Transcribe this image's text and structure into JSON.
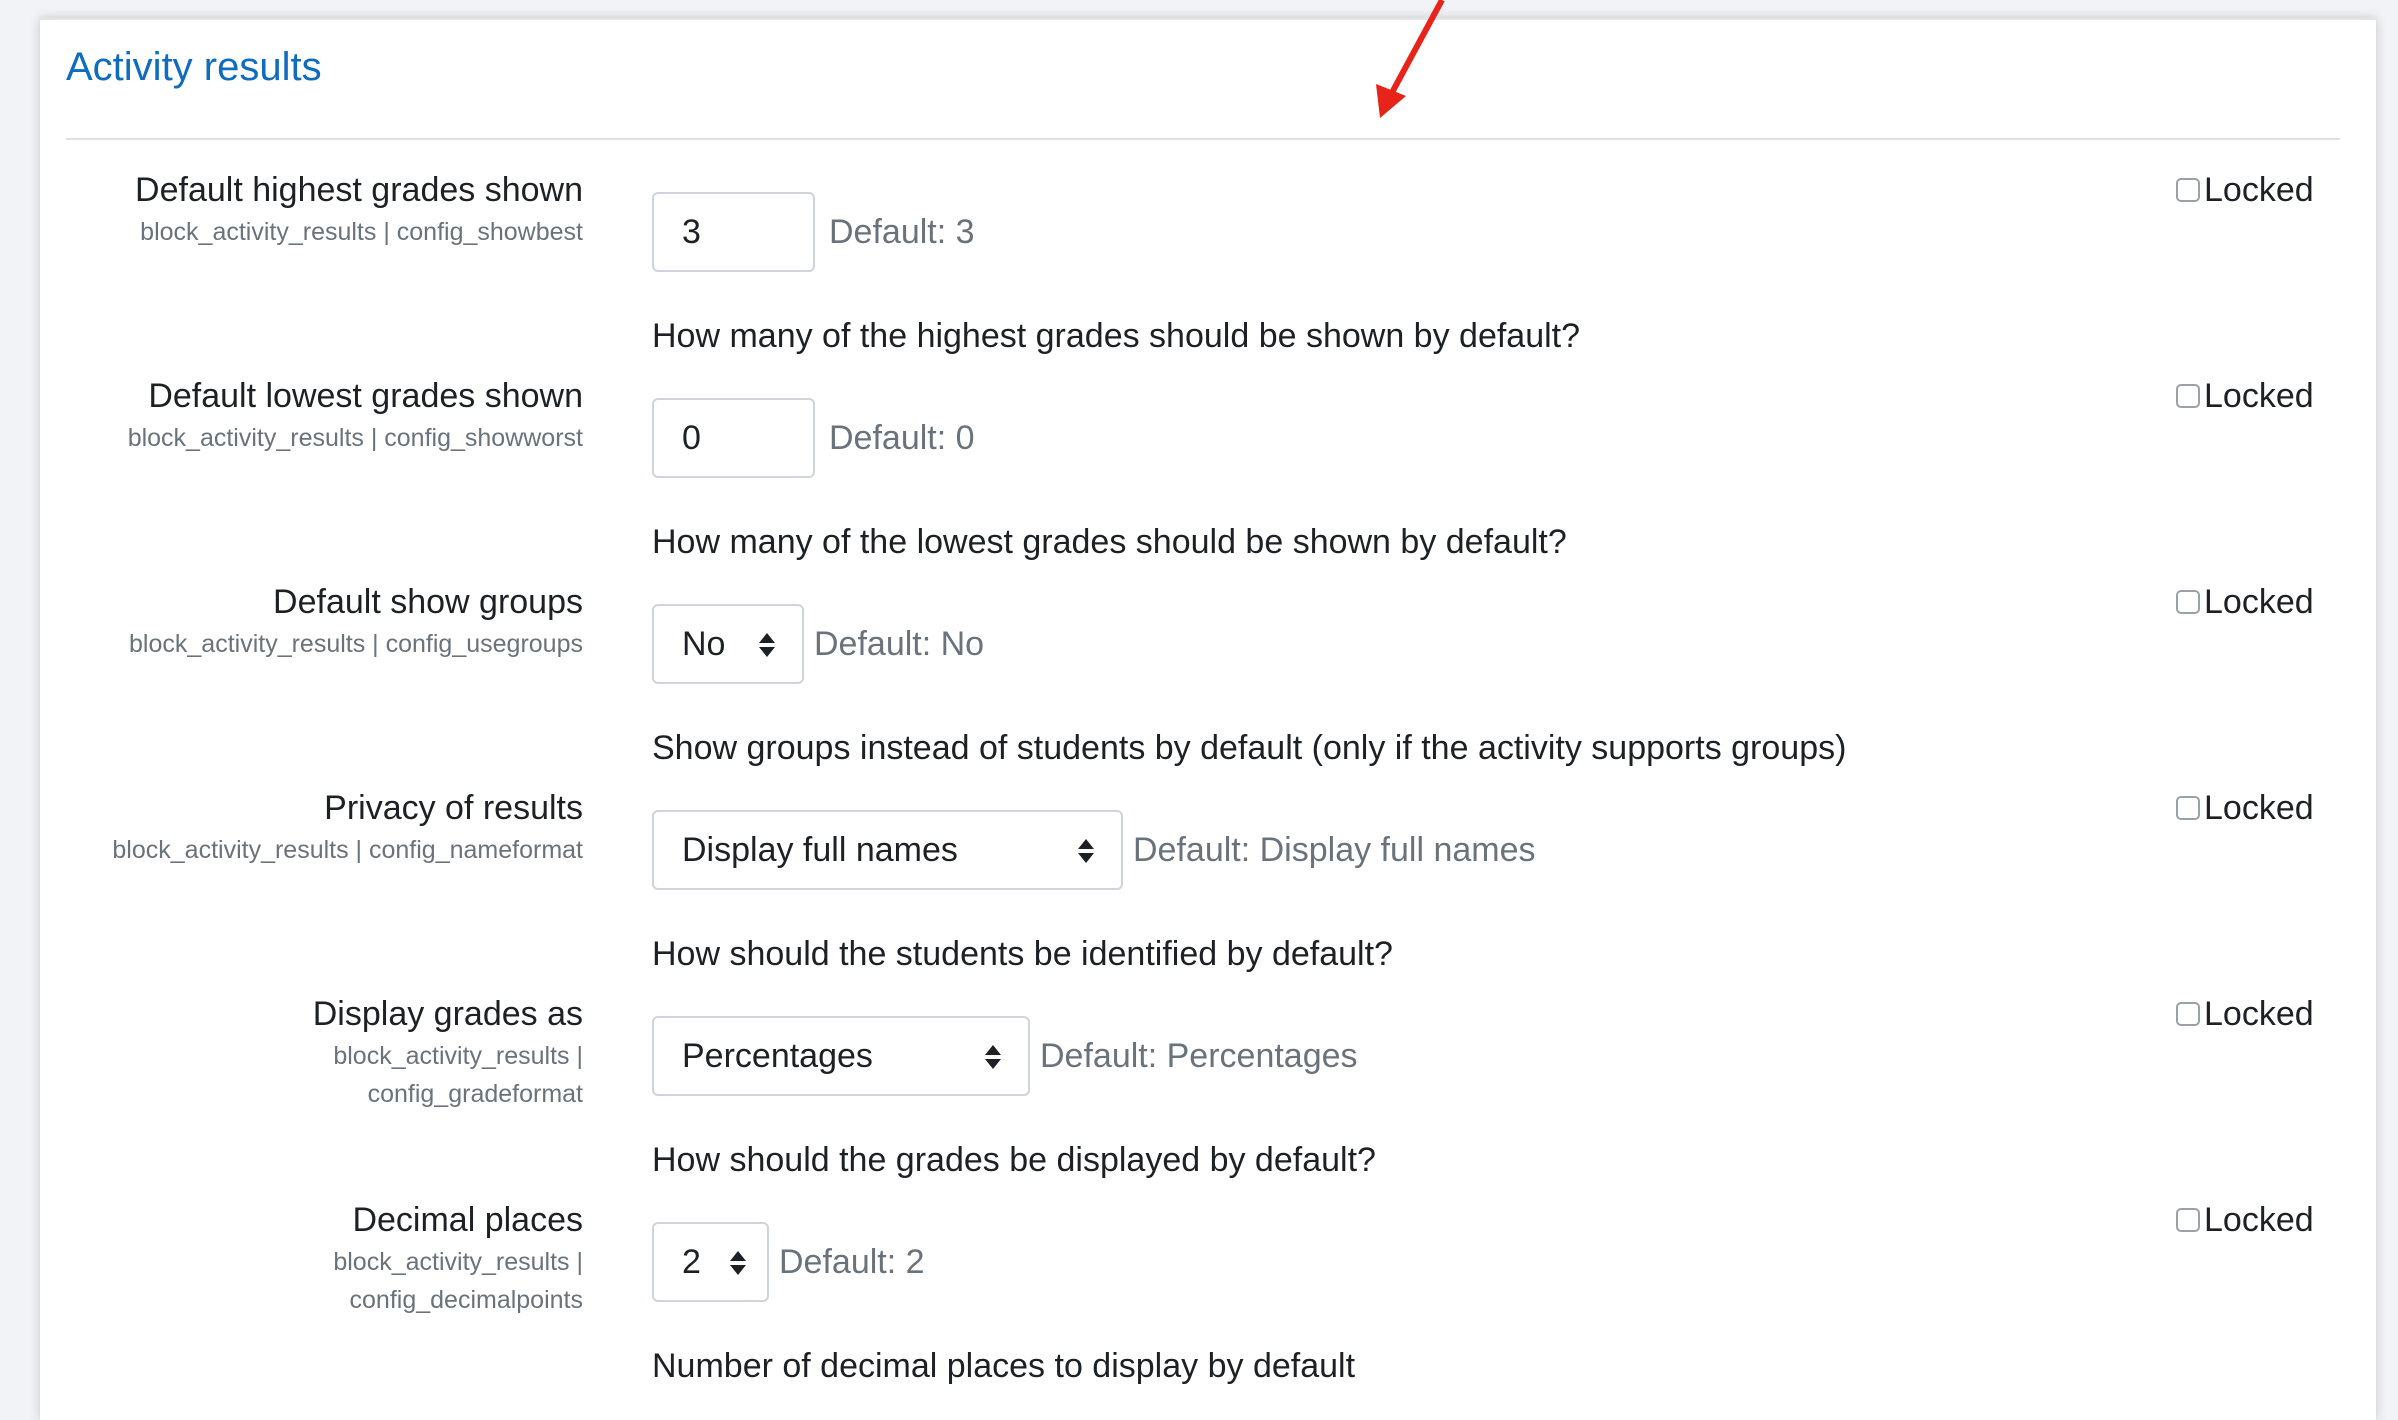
{
  "section": {
    "title": "Activity results"
  },
  "locked_label": "Locked",
  "settings": [
    {
      "label": "Default highest grades shown",
      "key": "block_activity_results | config_showbest",
      "value": "3",
      "default": "Default: 3",
      "description": "How many of the highest grades should be shown by default?"
    },
    {
      "label": "Default lowest grades shown",
      "key": "block_activity_results | config_showworst",
      "value": "0",
      "default": "Default: 0",
      "description": "How many of the lowest grades should be shown by default?"
    },
    {
      "label": "Default show groups",
      "key": "block_activity_results | config_usegroups",
      "value": "No",
      "default": "Default: No",
      "description": "Show groups instead of students by default (only if the activity supports groups)"
    },
    {
      "label": "Privacy of results",
      "key": "block_activity_results | config_nameformat",
      "value": "Display full names",
      "default": "Default: Display full names",
      "description": "How should the students be identified by default?"
    },
    {
      "label": "Display grades as",
      "key_line1": "block_activity_results |",
      "key_line2": "config_gradeformat",
      "value": "Percentages",
      "default": "Default: Percentages",
      "description": "How should the grades be displayed by default?"
    },
    {
      "label": "Decimal places",
      "key_line1": "block_activity_results |",
      "key_line2": "config_decimalpoints",
      "value": "2",
      "default": "Default: 2",
      "description": "Number of decimal places to display by default"
    }
  ],
  "colors": {
    "link": "#0f6cbf",
    "muted": "#6a737b",
    "annotation_arrow": "#e8231a"
  }
}
